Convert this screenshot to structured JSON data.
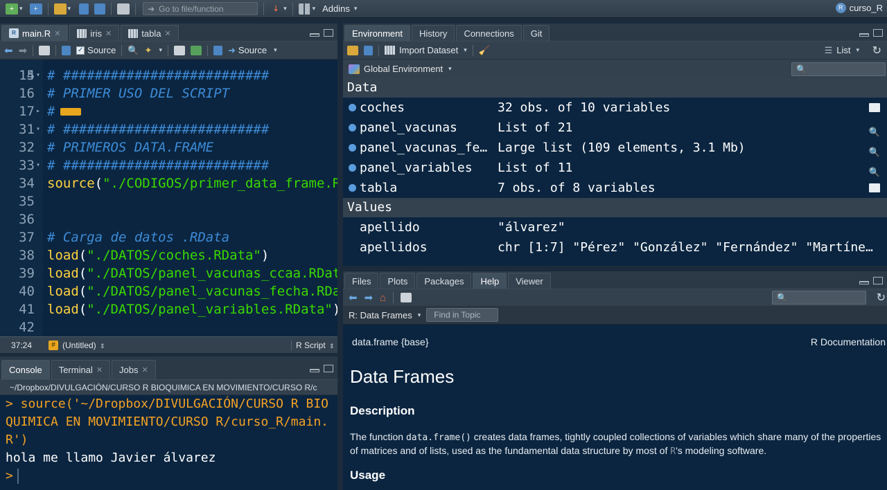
{
  "toolbar": {
    "goto_placeholder": "Go to file/function",
    "addins_label": "Addins",
    "project_name": "curso_R"
  },
  "editor": {
    "tabs": [
      {
        "label": "main.R",
        "icon": "r-file-icon"
      },
      {
        "label": "iris",
        "icon": "grid-icon"
      },
      {
        "label": "tabla",
        "icon": "grid-icon"
      }
    ],
    "source_on_save_label": "Source",
    "source_label": "Source",
    "lines": [
      {
        "num": "15",
        "fold": "▾",
        "code": "# ##########################",
        "kind": "cmt"
      },
      {
        "num": "16",
        "fold": "",
        "code": "# PRIMER USO DEL SCRIPT",
        "kind": "cmt"
      },
      {
        "num": "17",
        "fold": "▸",
        "code": "#",
        "kind": "cmt"
      },
      {
        "num": "31",
        "fold": "▾",
        "code": "# ##########################",
        "kind": "cmt"
      },
      {
        "num": "32",
        "fold": "",
        "code": "# PRIMEROS DATA.FRAME",
        "kind": "cmt"
      },
      {
        "num": "33",
        "fold": "▾",
        "code": "# ##########################",
        "kind": "cmt"
      },
      {
        "num": "34",
        "fold": "",
        "fn": "source",
        "arg": "\"./CODIGOS/primer_data_frame.R\"",
        "close": ")"
      },
      {
        "num": "35",
        "fold": "",
        "code": "",
        "kind": "plain"
      },
      {
        "num": "36",
        "fold": "",
        "code": "",
        "kind": "plain"
      },
      {
        "num": "37",
        "fold": "",
        "code": "# Carga de datos .RData",
        "kind": "cmt"
      },
      {
        "num": "38",
        "fold": "",
        "fn": "load",
        "arg": "\"./DATOS/coches.RData\"",
        "close": ")"
      },
      {
        "num": "39",
        "fold": "",
        "fn": "load",
        "arg": "\"./DATOS/panel_vacunas_ccaa.RData\"",
        "close": ")"
      },
      {
        "num": "40",
        "fold": "",
        "fn": "load",
        "arg": "\"./DATOS/panel_vacunas_fecha.RData\"",
        "close": ")"
      },
      {
        "num": "41",
        "fold": "",
        "fn": "load",
        "arg": "\"./DATOS/panel_variables.RData\"",
        "close": ")"
      },
      {
        "num": "42",
        "fold": "",
        "code": "",
        "kind": "plain"
      }
    ],
    "top_partial_line": "14",
    "status": {
      "position": "37:24",
      "scope": "(Untitled)",
      "file_type": "R Script"
    }
  },
  "console": {
    "tabs": [
      {
        "label": "Console"
      },
      {
        "label": "Terminal"
      },
      {
        "label": "Jobs"
      }
    ],
    "path": "~/Dropbox/DIVULGACIÓN/CURSO R BIOQUIMICA EN MOVIMIENTO/CURSO R/c",
    "lines": [
      {
        "text": "> source('~/Dropbox/DIVULGACIÓN/CURSO R BIO",
        "color": "orange"
      },
      {
        "text": "QUIMICA EN MOVIMIENTO/CURSO R/curso_R/main.",
        "color": "orange"
      },
      {
        "text": "R')",
        "color": "orange"
      },
      {
        "text": "hola me llamo Javier álvarez",
        "color": "white"
      }
    ],
    "prompt": ">"
  },
  "environment": {
    "tabs": [
      {
        "label": "Environment"
      },
      {
        "label": "History"
      },
      {
        "label": "Connections"
      },
      {
        "label": "Git"
      }
    ],
    "import_label": "Import Dataset",
    "view_label": "List",
    "scope_label": "Global Environment",
    "data_header": "Data",
    "values_header": "Values",
    "data_rows": [
      {
        "name": "coches",
        "value": "32 obs. of 10 variables",
        "action": "table"
      },
      {
        "name": "panel_vacunas",
        "value": "List of 21",
        "action": "search"
      },
      {
        "name": "panel_vacunas_fe…",
        "value": "Large list (109 elements, 3.1 Mb)",
        "action": "search"
      },
      {
        "name": "panel_variables",
        "value": "List of 11",
        "action": "search"
      },
      {
        "name": "tabla",
        "value": "7 obs. of 8 variables",
        "action": "table"
      }
    ],
    "value_rows": [
      {
        "name": "apellido",
        "value": "\"álvarez\""
      },
      {
        "name": "apellidos",
        "value": "chr [1:7] \"Pérez\" \"González\" \"Fernández\" \"Martíne…"
      }
    ]
  },
  "help": {
    "tabs": [
      {
        "label": "Files"
      },
      {
        "label": "Plots"
      },
      {
        "label": "Packages"
      },
      {
        "label": "Help"
      },
      {
        "label": "Viewer"
      }
    ],
    "topic_label": "R: Data Frames",
    "find_placeholder": "Find in Topic",
    "header_left": "data.frame {base}",
    "header_right": "R Documentation",
    "title": "Data Frames",
    "description_heading": "Description",
    "description_before": "The function ",
    "description_code": "data.frame()",
    "description_after": " creates data frames, tightly coupled collections of variables which share many of the properties of matrices and of lists, used as the fundamental data structure by most of ",
    "description_r": "R",
    "description_end": "'s modeling software.",
    "usage_heading": "Usage"
  },
  "colors": {
    "editor_bg": "#0b2540",
    "comment": "#3d8bd6",
    "function": "#ffd23f",
    "string": "#3ad900",
    "console_orange": "#f4a224"
  }
}
